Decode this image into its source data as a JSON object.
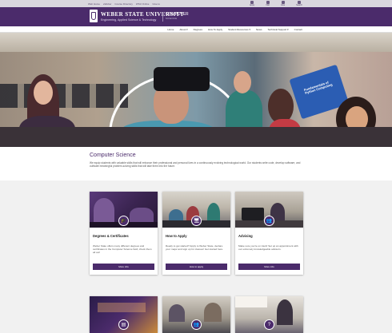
{
  "utility": {
    "links": [
      "Web Home",
      "eWeber",
      "Course Directory",
      "WSU Online",
      "Give to"
    ],
    "icons": [
      {
        "name": "apply-icon",
        "label": "Apply"
      },
      {
        "name": "visit-icon",
        "label": "Visit"
      },
      {
        "name": "give-icon",
        "label": "Give"
      },
      {
        "name": "search-icon",
        "label": "Search"
      }
    ]
  },
  "header": {
    "university": "WEBER STATE UNIVERSITY",
    "college": "Engineering, Applied Science & Technology",
    "department": "COMPUTER",
    "department_sub": "SCIENCE"
  },
  "nav": {
    "items": [
      {
        "label": "Home"
      },
      {
        "label": "About ▾"
      },
      {
        "label": "Degrees"
      },
      {
        "label": "How To Apply"
      },
      {
        "label": "Student Resources ▾"
      },
      {
        "label": "News"
      },
      {
        "label": "Technical Support ▾"
      },
      {
        "label": "Contact"
      }
    ]
  },
  "hero": {
    "book_title": "Fundamentals of Python Computing"
  },
  "intro": {
    "title": "Computer Science",
    "text": "We equip students with valuable skills that will enhance their professional and personal lives in a continuously evolving technological world. Our students write code, develop software, and cultivate meaningful problem-solving skills that will take them into the future."
  },
  "cards": [
    {
      "title": "Degrees & Certificates",
      "description": "Weber State offers many different degrees and certificates in the Computer Science field; check them all out!",
      "button": "More info",
      "icon": "graduation-cap-icon",
      "icon_glyph": "🎓"
    },
    {
      "title": "How to Apply",
      "description": "Ready to get started? Apply to Weber State, declare your major and sign up for classes! Get started here.",
      "button": "How to apply",
      "icon": "monitor-icon",
      "icon_glyph": "🖥"
    },
    {
      "title": "Advising",
      "description": "Make sure you're on track! Set up an appointment with our extremely knowledgeable advisors.",
      "button": "More info",
      "icon": "people-icon",
      "icon_glyph": "👥"
    }
  ],
  "cards_row2": [
    {
      "icon": "computer-lab-icon",
      "icon_glyph": "▤"
    },
    {
      "icon": "group-icon",
      "icon_glyph": "👥"
    },
    {
      "icon": "question-icon",
      "icon_glyph": "?"
    }
  ],
  "colors": {
    "brand_purple": "#4b2b6b",
    "utility_bar": "#d9d6de",
    "page_bg": "#f1f1f1"
  }
}
